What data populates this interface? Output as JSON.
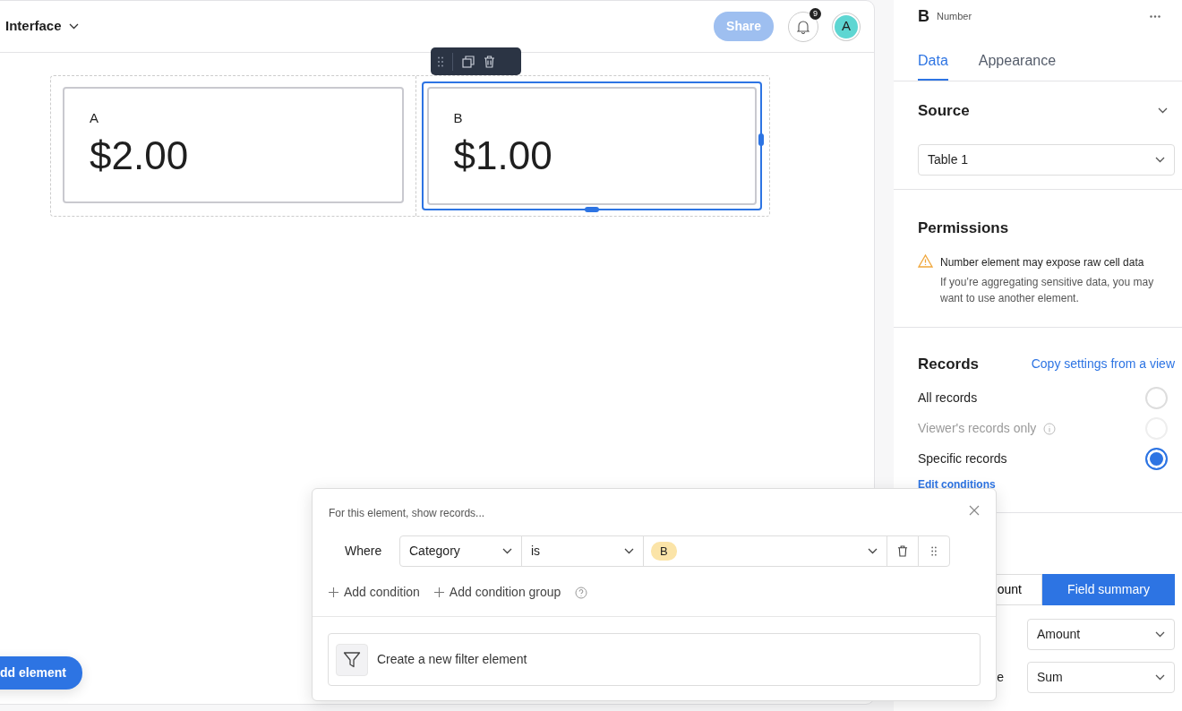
{
  "header": {
    "title": "Interface",
    "share_label": "Share",
    "notification_count": "9",
    "avatar_initial": "A"
  },
  "cards": [
    {
      "label": "A",
      "value": "$2.00",
      "selected": false
    },
    {
      "label": "B",
      "value": "$1.00",
      "selected": true
    }
  ],
  "add_element_label": "dd element",
  "panel": {
    "element_name": "B",
    "element_type": "Number",
    "tabs": [
      {
        "label": "Data",
        "selected": true
      },
      {
        "label": "Appearance",
        "selected": false
      }
    ],
    "source": {
      "title": "Source",
      "table": "Table 1"
    },
    "permissions": {
      "title": "Permissions",
      "warning_title": "Number element may expose raw cell data",
      "warning_text": "If you’re aggregating sensitive data, you may want to use another element."
    },
    "records": {
      "title": "Records",
      "copy_link": "Copy settings from a view",
      "options": [
        {
          "label": "All records",
          "selected": false,
          "disabled": false,
          "info": false
        },
        {
          "label": "Viewer's records only",
          "selected": false,
          "disabled": true,
          "info": true
        },
        {
          "label": "Specific records",
          "selected": true,
          "disabled": false,
          "info": false
        }
      ],
      "edit_link": "Edit conditions"
    },
    "summary": {
      "modes": [
        {
          "label": "ount",
          "selected": false
        },
        {
          "label": "Field summary",
          "selected": true
        }
      ],
      "rows": [
        {
          "value": "Amount"
        },
        {
          "label": "e",
          "value": "Sum"
        }
      ]
    }
  },
  "filter_popover": {
    "title": "For this element, show records...",
    "where_label": "Where",
    "field": "Category",
    "operator": "is",
    "value_tag": "B",
    "add_condition": "Add condition",
    "add_group": "Add condition group",
    "create_filter": "Create a new filter element"
  }
}
